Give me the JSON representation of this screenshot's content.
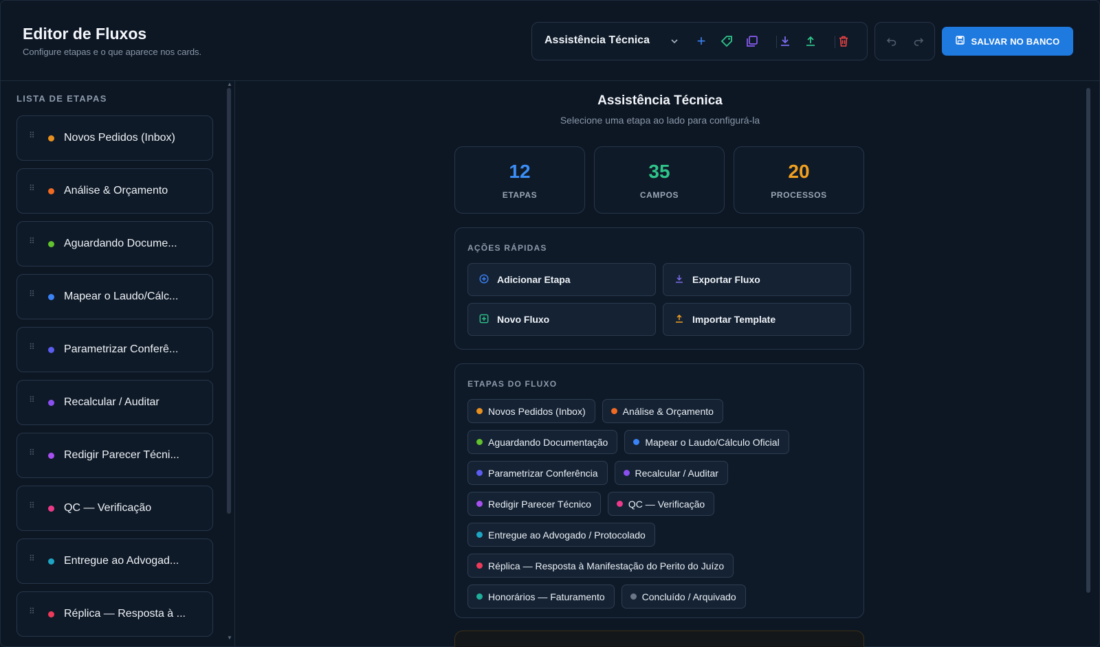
{
  "header": {
    "title": "Editor de Fluxos",
    "subtitle": "Configure etapas e o que aparece nos cards.",
    "flow_select": "Assistência Técnica",
    "save_label": "SALVAR NO BANCO"
  },
  "colors": {
    "accent": "#1f7ae0",
    "orange": "#e8901f",
    "green": "#2fc48a",
    "blue": "#3b82f6"
  },
  "sidebar": {
    "heading": "LISTA DE ETAPAS",
    "items": [
      {
        "label": "Novos Pedidos (Inbox)",
        "color": "#e8901f"
      },
      {
        "label": "Análise & Orçamento",
        "color": "#f06a22"
      },
      {
        "label": "Aguardando Docume...",
        "color": "#62c12e"
      },
      {
        "label": "Mapear o Laudo/Cálc...",
        "color": "#3b82f6"
      },
      {
        "label": "Parametrizar Conferê...",
        "color": "#5b5cf0"
      },
      {
        "label": "Recalcular / Auditar",
        "color": "#8b4ff0"
      },
      {
        "label": "Redigir Parecer Técni...",
        "color": "#a84ff0"
      },
      {
        "label": "QC — Verificação",
        "color": "#ec3a8a"
      },
      {
        "label": "Entregue ao Advogad...",
        "color": "#1ea5c4"
      },
      {
        "label": "Réplica — Resposta à ...",
        "color": "#ec3a5a"
      }
    ]
  },
  "main": {
    "title": "Assistência Técnica",
    "subtitle": "Selecione uma etapa ao lado para configurá-la",
    "stats": [
      {
        "value": "12",
        "label": "ETAPAS",
        "color": "#3b8ef6"
      },
      {
        "value": "35",
        "label": "CAMPOS",
        "color": "#2fc48a"
      },
      {
        "value": "20",
        "label": "PROCESSOS",
        "color": "#f0a020"
      }
    ],
    "quick_actions": {
      "heading": "AÇÕES RÁPIDAS",
      "add_stage": "Adicionar Etapa",
      "export_flow": "Exportar Fluxo",
      "new_flow": "Novo Fluxo",
      "import_template": "Importar Template"
    },
    "flow_stages": {
      "heading": "ETAPAS DO FLUXO",
      "rows": [
        [
          {
            "label": "Novos Pedidos (Inbox)",
            "color": "#e8901f"
          },
          {
            "label": "Análise & Orçamento",
            "color": "#f06a22"
          }
        ],
        [
          {
            "label": "Aguardando Documentação",
            "color": "#62c12e"
          },
          {
            "label": "Mapear o Laudo/Cálculo Oficial",
            "color": "#3b82f6"
          }
        ],
        [
          {
            "label": "Parametrizar Conferência",
            "color": "#5b5cf0"
          },
          {
            "label": "Recalcular / Auditar",
            "color": "#8b4ff0"
          }
        ],
        [
          {
            "label": "Redigir Parecer Técnico",
            "color": "#a84ff0"
          },
          {
            "label": "QC — Verificação",
            "color": "#ec3a8a"
          }
        ],
        [
          {
            "label": "Entregue ao Advogado / Protocolado",
            "color": "#1ea5c4"
          }
        ],
        [
          {
            "label": "Réplica — Resposta à Manifestação do Perito do Juízo",
            "color": "#ec3a5a"
          }
        ],
        [
          {
            "label": "Honorários — Faturamento",
            "color": "#1fae9a"
          },
          {
            "label": "Concluído / Arquivado",
            "color": "#6b7686"
          }
        ]
      ]
    }
  }
}
